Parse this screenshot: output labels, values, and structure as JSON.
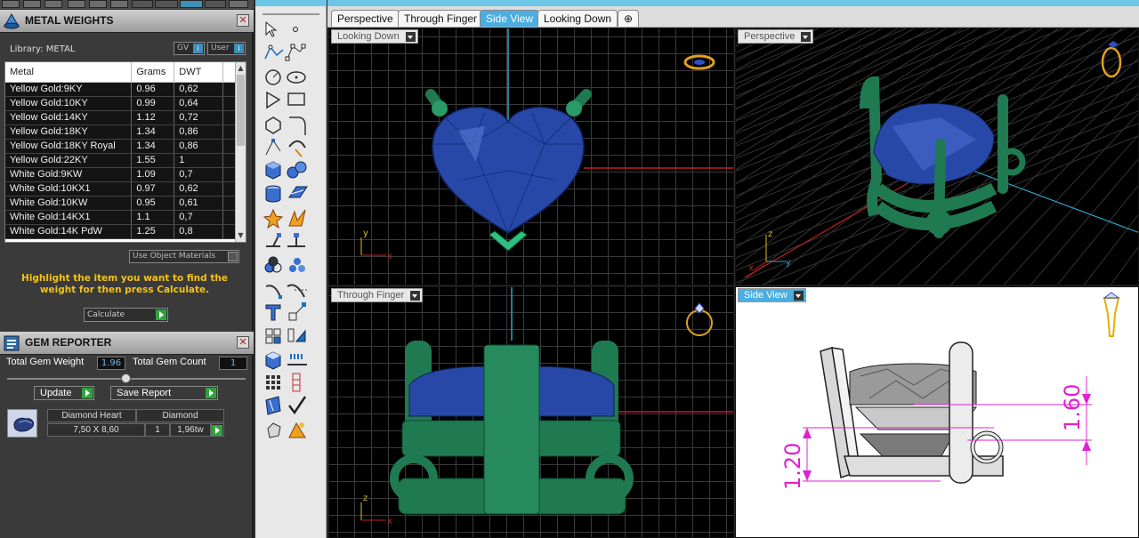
{
  "metal_panel": {
    "title": "METAL WEIGHTS",
    "library_label": "Library: METAL",
    "gv_label": "GV",
    "user_label": "User",
    "columns": [
      "Metal",
      "Grams",
      "DWT"
    ],
    "rows": [
      [
        "Yellow Gold:9KY",
        "0.96",
        "0,62"
      ],
      [
        "Yellow Gold:10KY",
        "0.99",
        "0,64"
      ],
      [
        "Yellow Gold:14KY",
        "1.12",
        "0,72"
      ],
      [
        "Yellow Gold:18KY",
        "1.34",
        "0,86"
      ],
      [
        "Yellow Gold:18KY Royal",
        "1.34",
        "0,86"
      ],
      [
        "Yellow Gold:22KY",
        "1.55",
        "1"
      ],
      [
        "White Gold:9KW",
        "1.09",
        "0,7"
      ],
      [
        "White Gold:10KX1",
        "0.97",
        "0,62"
      ],
      [
        "White Gold:10KW",
        "0.95",
        "0,61"
      ],
      [
        "White Gold:14KX1",
        "1.1",
        "0,7"
      ],
      [
        "White Gold:14K PdW",
        "1.25",
        "0,8"
      ]
    ],
    "use_object_materials": "Use Object Materials",
    "hint": "Highlight the item you want to find the weight for then press Calculate.",
    "calculate": "Calculate"
  },
  "gem_panel": {
    "title": "GEM REPORTER",
    "total_weight_label": "Total Gem Weight",
    "total_weight_value": "1.96",
    "total_count_label": "Total Gem Count",
    "total_count_value": "1",
    "update": "Update",
    "save_report": "Save Report",
    "gem": {
      "name": "Diamond Heart",
      "type": "Diamond",
      "size": "7,50 X 8,60",
      "count": "1",
      "weight": "1,96tw"
    }
  },
  "tabs": [
    "Perspective",
    "Through Finger",
    "Side View",
    "Looking Down"
  ],
  "active_tab": "Side View",
  "viewports": {
    "top_left": "Looking Down",
    "top_right": "Perspective",
    "bottom_left": "Through Finger",
    "bottom_right": "Side View"
  },
  "dimensions": {
    "left": "1.20",
    "right": "1.60"
  },
  "axes": {
    "x": "x",
    "y": "y",
    "z": "z"
  },
  "colors": {
    "accent": "#4aaee0",
    "gem": "#2848a8",
    "metal": "#1f7a52",
    "dimension": "#e020d0",
    "hint": "#f3c218"
  }
}
